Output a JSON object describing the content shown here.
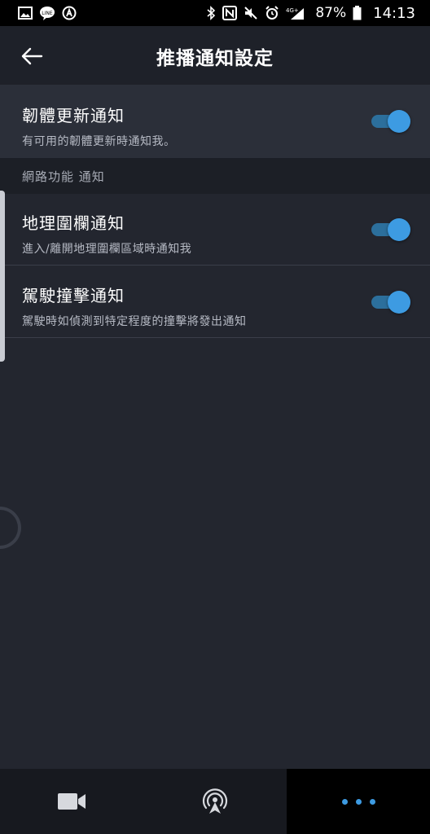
{
  "status_bar": {
    "battery": "87%",
    "time": "14:13",
    "network": "4G+",
    "left_icons": [
      "gallery-icon",
      "line-icon",
      "a-icon"
    ],
    "right_icons": [
      "bluetooth-icon",
      "nfc-icon",
      "mute-icon",
      "alarm-icon",
      "network-icon",
      "battery-icon"
    ]
  },
  "header": {
    "title": "推播通知設定",
    "back_icon": "arrow-left-icon"
  },
  "settings": {
    "firmware": {
      "title": "韌體更新通知",
      "subtitle": "有可用的韌體更新時通知我。",
      "enabled": true
    },
    "section_label": "網路功能 通知",
    "geofence": {
      "title": "地理圍欄通知",
      "subtitle": "進入/離開地理圍欄區域時通知我",
      "enabled": true
    },
    "crash": {
      "title": "駕駛撞擊通知",
      "subtitle": "駕駛時如偵測到特定程度的撞擊將發出通知",
      "enabled": true
    }
  },
  "bottom_nav": {
    "items": [
      {
        "icon": "video-camera-icon",
        "active": false
      },
      {
        "icon": "broadcast-icon",
        "active": false
      },
      {
        "icon": "more-dots-icon",
        "active": true
      }
    ]
  },
  "colors": {
    "background": "#23262f",
    "accent": "#3d9be2",
    "toggle_track": "#2c6f9c"
  }
}
